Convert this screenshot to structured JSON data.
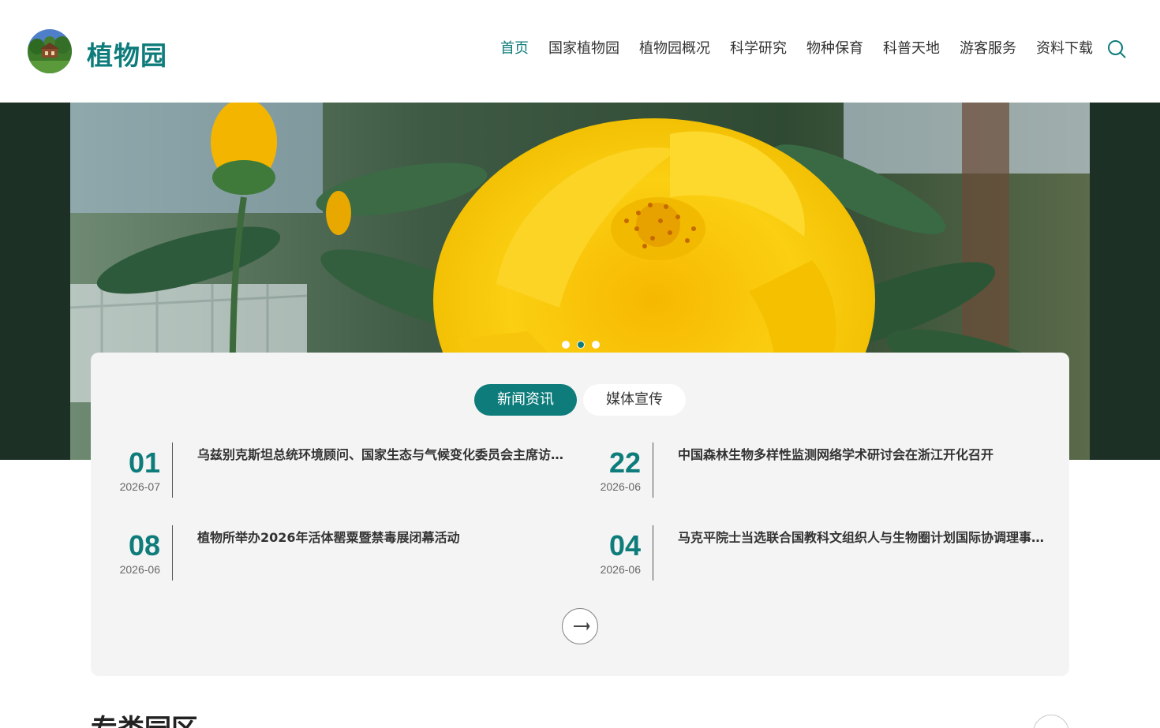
{
  "header": {
    "site_name": "植物园",
    "logo_icon": "garden-logo-icon",
    "search_icon": "search-icon",
    "nav": [
      {
        "label": "首页",
        "active": true
      },
      {
        "label": "国家植物园",
        "active": false
      },
      {
        "label": "植物园概况",
        "active": false
      },
      {
        "label": "科学研究",
        "active": false
      },
      {
        "label": "物种保育",
        "active": false
      },
      {
        "label": "科普天地",
        "active": false
      },
      {
        "label": "游客服务",
        "active": false
      },
      {
        "label": "资料下载",
        "active": false
      }
    ]
  },
  "banner": {
    "image": "yellow-rose-photo",
    "slide_count": 3,
    "active_slide": 2
  },
  "news": {
    "tabs": [
      {
        "label": "新闻资讯",
        "active": true
      },
      {
        "label": "媒体宣传",
        "active": false
      }
    ],
    "items": [
      {
        "day": "01",
        "ym": "2026-07",
        "title": "乌兹别克斯坦总统环境顾问、国家生态与气候变化委员会主席访问国家植物园"
      },
      {
        "day": "22",
        "ym": "2026-06",
        "title": "中国森林生物多样性监测网络学术研讨会在浙江开化召开"
      },
      {
        "day": "08",
        "ym": "2026-06",
        "title": "植物所举办2026年活体罂粟暨禁毒展闭幕活动"
      },
      {
        "day": "04",
        "ym": "2026-06",
        "title": "马克平院士当选联合国教科文组织人与生物圈计划国际协调理事会主席"
      }
    ],
    "more_icon": "arrow-right-icon"
  },
  "next_section": {
    "title": "专类园区",
    "nav_icon": "chevron-icon"
  },
  "colors": {
    "accent": "#0e7c7b",
    "banner_bg": "#1d3026",
    "panel_bg": "#f3f4f3"
  }
}
